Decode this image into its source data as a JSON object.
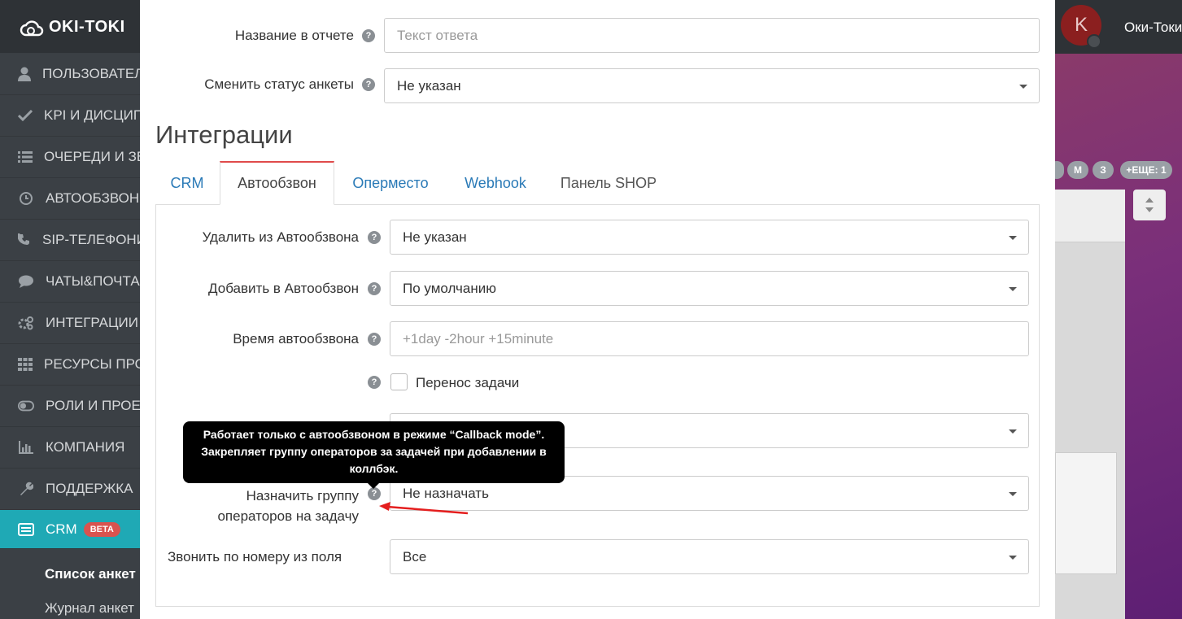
{
  "app": {
    "logo_text": "OKI-TOKI",
    "user_initial": "K",
    "user_name": "Оки-Токи"
  },
  "sidebar": {
    "items": [
      {
        "label": "ПОЛЬЗОВАТЕЛИ",
        "icon": "user-icon"
      },
      {
        "label": "KPI И ДИСЦИПЛИНА",
        "icon": "check-icon"
      },
      {
        "label": "ОЧЕРЕДИ И ЗВОНКИ",
        "icon": "list-icon"
      },
      {
        "label": "АВТООБЗВОН",
        "icon": "clock-icon"
      },
      {
        "label": "SIP-ТЕЛЕФОНИЯ",
        "icon": "phone-icon"
      },
      {
        "label": "ЧАТЫ&ПОЧТА",
        "icon": "chat-icon"
      },
      {
        "label": "ИНТЕГРАЦИИ",
        "icon": "gears-icon"
      },
      {
        "label": "РЕСУРСЫ ПРОЕКТА",
        "icon": "grid-icon"
      },
      {
        "label": "РОЛИ И ПРОЕКТЫ",
        "icon": "toggle-icon"
      },
      {
        "label": "КОМПАНИЯ",
        "icon": "bar-chart-icon"
      },
      {
        "label": "ПОДДЕРЖКА",
        "icon": "wrench-icon"
      },
      {
        "label": "CRM",
        "icon": "crm-icon",
        "badge": "BETA"
      }
    ],
    "sub_items": [
      "Список анкет",
      "Журнал анкет"
    ]
  },
  "bg_pills": [
    "M",
    "З",
    "+ЕЩЕ: 1"
  ],
  "form_top": {
    "report_name_label": "Название в отчете",
    "report_name_placeholder": "Текст ответа",
    "status_label": "Сменить статус анкеты",
    "status_value": "Не указан"
  },
  "section_title": "Интеграции",
  "tabs": [
    {
      "label": "CRM",
      "active": false
    },
    {
      "label": "Автообзвон",
      "active": true
    },
    {
      "label": "Оперместо",
      "active": false
    },
    {
      "label": "Webhook",
      "active": false
    },
    {
      "label": "Панель SHOP",
      "active": false
    }
  ],
  "autocall": {
    "remove_label": "Удалить из Автообзвона",
    "remove_value": "Не указан",
    "add_label": "Добавить в Автообзвон",
    "add_value": "По умолчанию",
    "time_label": "Время автообзвона",
    "time_placeholder": "+1day -2hour +15minute",
    "transfer_label": "Перенос задачи",
    "assign_label_line1": "Назначить группу",
    "assign_label_line2": "операторов на задачу",
    "assign_value": "Не назначать",
    "call_field_label": "Звонить по номеру из поля",
    "call_field_value": "Все"
  },
  "tooltip": {
    "line1": "Работает только с автообзвоном в режиме “Callback mode”.",
    "line2": "Закрепляет группу операторов за задачей при добавлении в",
    "line3": "коллбэк."
  },
  "colors": {
    "accent": "#1fa9b5",
    "tab_active_border": "#e04b4b",
    "link": "#2a7ab7",
    "badge": "#d9534f",
    "annotation_arrow": "#e41e1e"
  }
}
